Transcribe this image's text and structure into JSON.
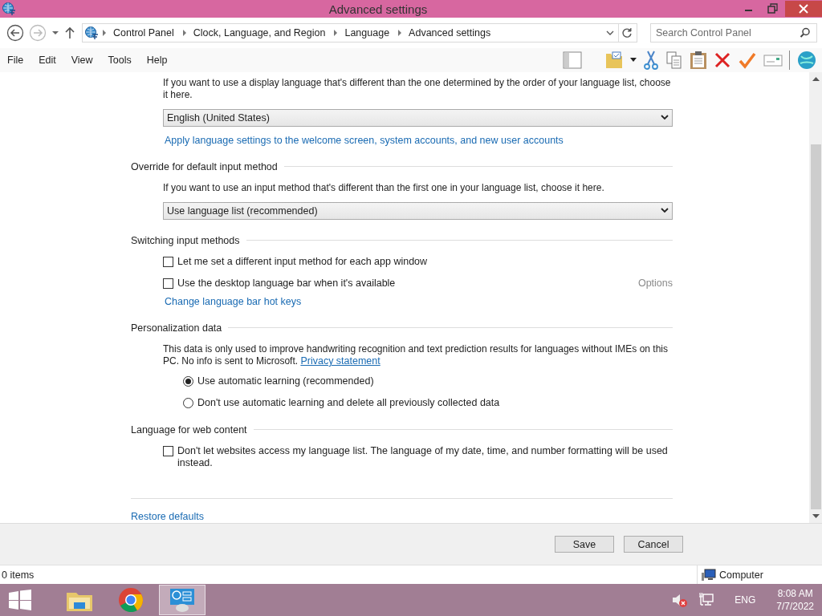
{
  "window": {
    "title": "Advanced settings"
  },
  "address_bar": {
    "breadcrumbs": [
      "Control Panel",
      "Clock, Language, and Region",
      "Language",
      "Advanced settings"
    ]
  },
  "search": {
    "placeholder": "Search Control Panel"
  },
  "menu": [
    "File",
    "Edit",
    "View",
    "Tools",
    "Help"
  ],
  "content": {
    "sections": [
      {
        "items": [
          {
            "kind": "text",
            "text": "If you want to use a display language that's different than the one determined by the order of your language list, choose it here."
          },
          {
            "kind": "dropdown",
            "value": "English (United States)"
          },
          {
            "kind": "link",
            "text": "Apply language settings to the welcome screen, system accounts, and new user accounts"
          }
        ]
      },
      {
        "heading": "Override for default input method",
        "items": [
          {
            "kind": "text",
            "text": "If you want to use an input method that's different than the first one in your language list, choose it here."
          },
          {
            "kind": "dropdown",
            "value": "Use language list (recommended)"
          }
        ]
      },
      {
        "heading": "Switching input methods",
        "items": [
          {
            "kind": "checkbox",
            "label": "Let me set a different input method for each app window",
            "checked": false
          },
          {
            "kind": "checkbox",
            "label": "Use the desktop language bar when it's available",
            "checked": false,
            "option": {
              "label": "Options",
              "disabled": true
            }
          },
          {
            "kind": "link",
            "text": "Change language bar hot keys"
          }
        ]
      },
      {
        "heading": "Personalization data",
        "items": [
          {
            "kind": "text",
            "text": "This data is only used to improve handwriting recognition and text prediction results for languages without IMEs on this PC. No info is sent to Microsoft.",
            "link": "Privacy statement"
          },
          {
            "kind": "radio",
            "label": "Use automatic learning (recommended)",
            "selected": true
          },
          {
            "kind": "radio",
            "label": "Don't use automatic learning and delete all previously collected data",
            "selected": false
          }
        ]
      },
      {
        "heading": "Language for web content",
        "items": [
          {
            "kind": "checkbox",
            "label": "Don't let websites access my language list. The language of my date, time, and number formatting will be used instead.",
            "checked": false
          }
        ]
      }
    ],
    "restore_link": "Restore defaults"
  },
  "buttons": [
    "Save",
    "Cancel"
  ],
  "status_bar": {
    "items": "0 items",
    "location": "Computer"
  },
  "taskbar": {
    "apps": [
      {
        "kind": "folder",
        "selected": false
      },
      {
        "kind": "browser",
        "selected": false
      },
      {
        "kind": "control-panel",
        "selected": true
      }
    ],
    "language": "ENG",
    "time": "8:08 AM",
    "date": "7/7/2022"
  }
}
